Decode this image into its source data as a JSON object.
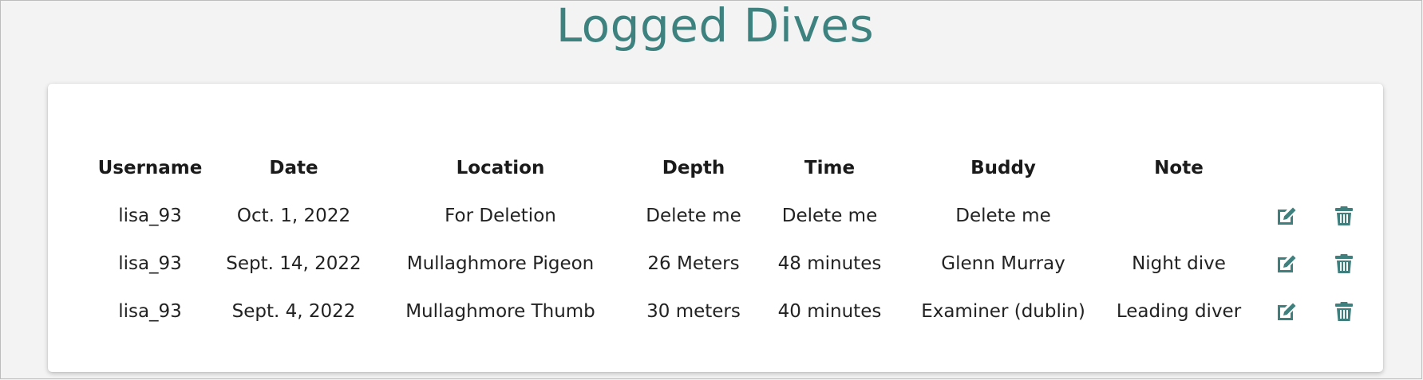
{
  "page": {
    "title": "Logged Dives"
  },
  "table": {
    "headers": {
      "username": "Username",
      "date": "Date",
      "location": "Location",
      "depth": "Depth",
      "time": "Time",
      "buddy": "Buddy",
      "note": "Note"
    },
    "rows": [
      {
        "username": "lisa_93",
        "date": "Oct. 1, 2022",
        "location": "For Deletion",
        "depth": "Delete me",
        "time": "Delete me",
        "buddy": "Delete me",
        "note": ""
      },
      {
        "username": "lisa_93",
        "date": "Sept. 14, 2022",
        "location": "Mullaghmore Pigeon",
        "depth": "26 Meters",
        "time": "48 minutes",
        "buddy": "Glenn Murray",
        "note": "Night dive"
      },
      {
        "username": "lisa_93",
        "date": "Sept. 4, 2022",
        "location": "Mullaghmore Thumb",
        "depth": "30 meters",
        "time": "40 minutes",
        "buddy": "Examiner (dublin)",
        "note": "Leading diver"
      }
    ]
  },
  "icons": {
    "edit": "edit-icon",
    "delete": "trash-icon"
  },
  "colors": {
    "accent": "#3e8280",
    "icon": "#3f7f7d",
    "background": "#f3f3f3",
    "card": "#ffffff"
  }
}
